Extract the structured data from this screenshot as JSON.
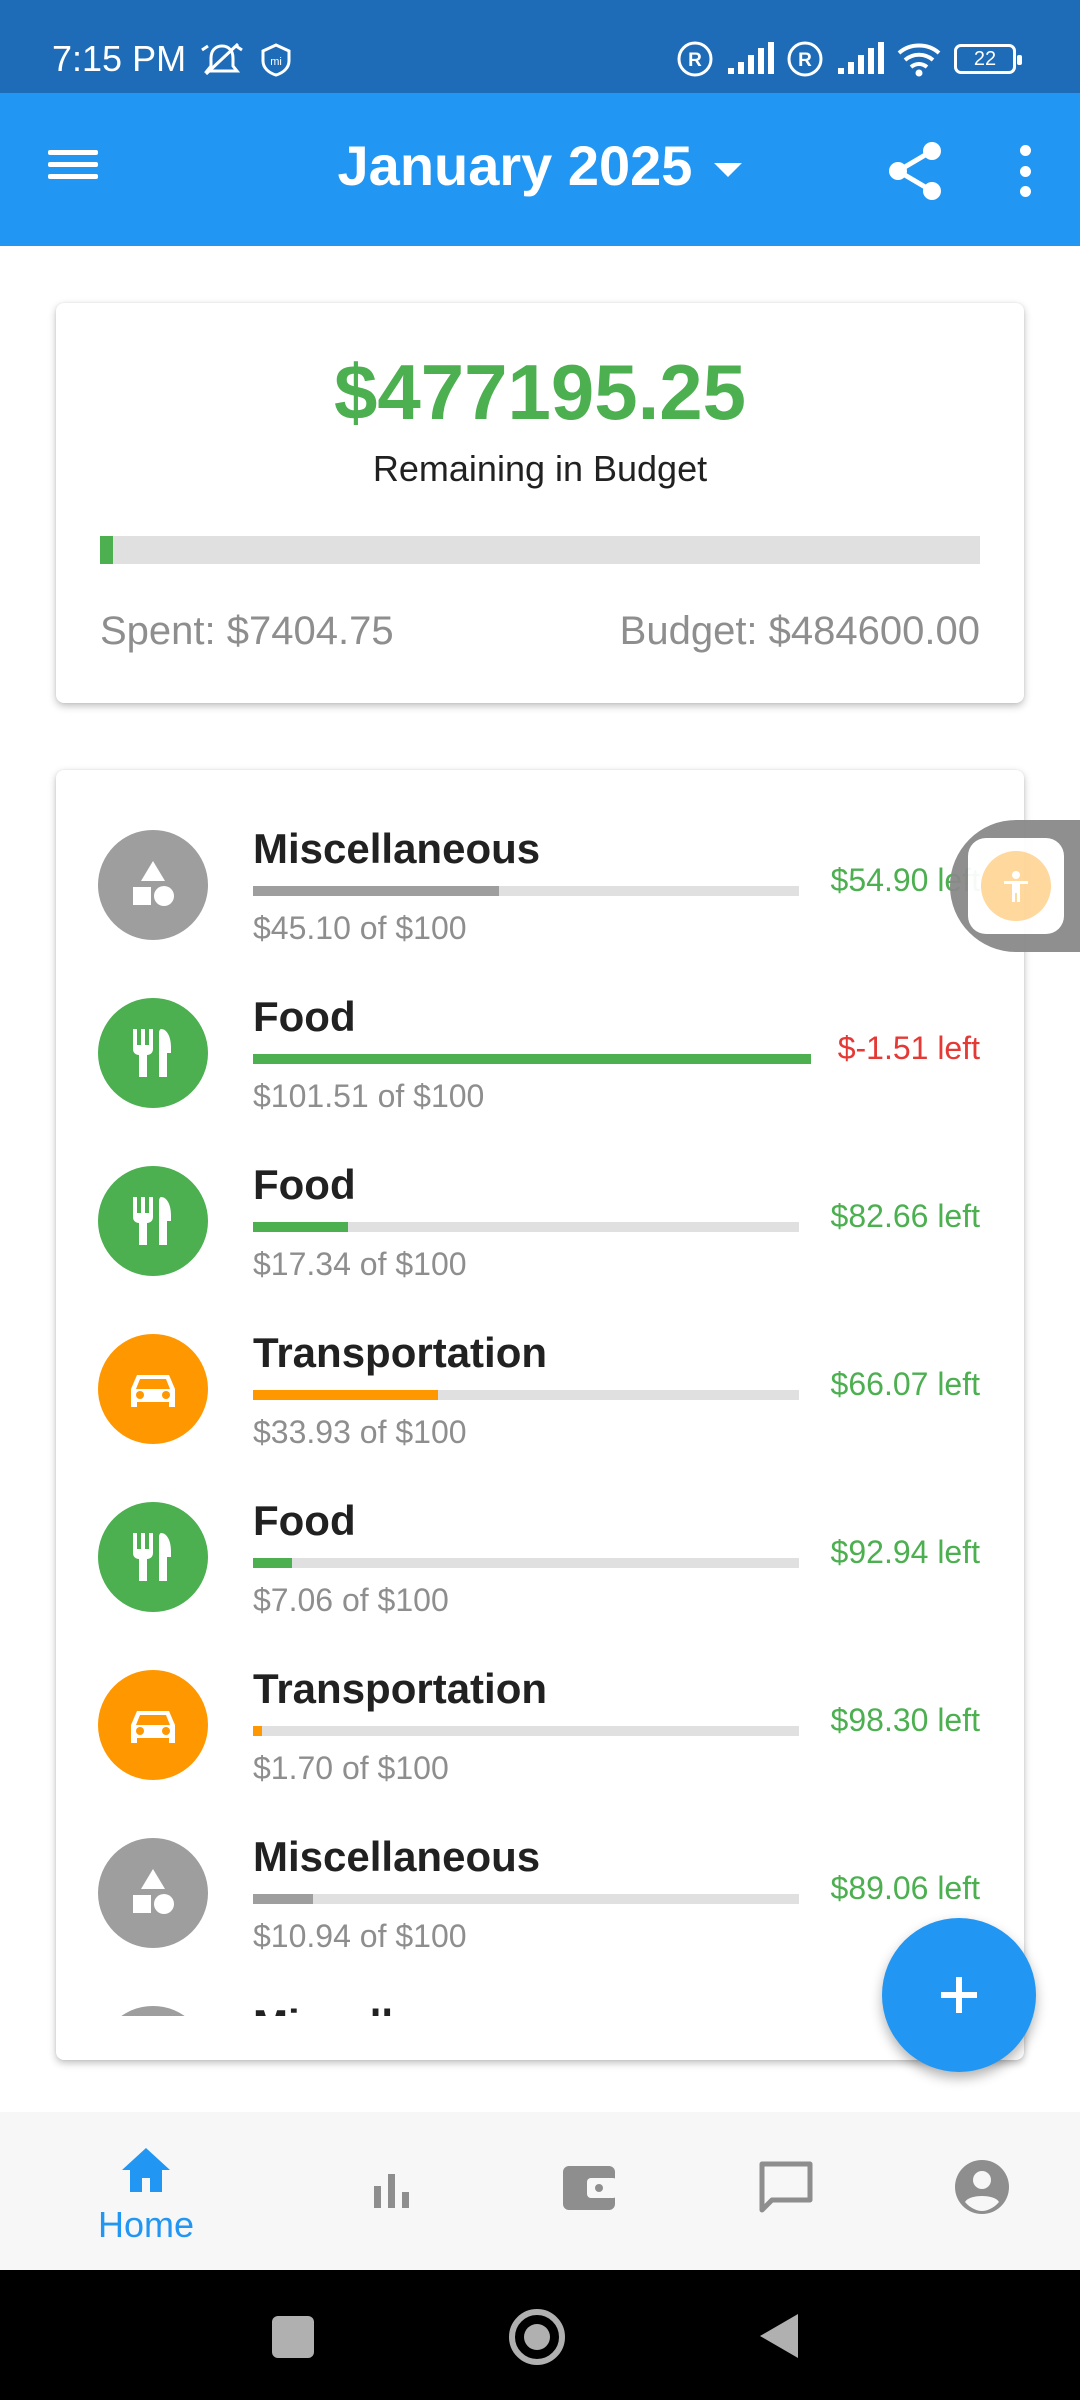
{
  "status_bar": {
    "time": "7:15 PM",
    "battery": "22"
  },
  "app_bar": {
    "title": "January 2025"
  },
  "summary": {
    "remaining_amount": "$477195.25",
    "remaining_label": "Remaining in Budget",
    "spent": "Spent: $7404.75",
    "budget": "Budget: $484600.00",
    "progress_fraction": 0.0153,
    "accent_color": "#4caf50"
  },
  "categories": [
    {
      "name": "Miscellaneous",
      "icon": "shapes-icon",
      "color": "#9e9e9e",
      "spent_text": "$45.10 of $100",
      "left_text": "$54.90 left",
      "progress": 0.451,
      "over": false
    },
    {
      "name": "Food",
      "icon": "restaurant-icon",
      "color": "#4caf50",
      "spent_text": "$101.51 of $100",
      "left_text": "$-1.51 left",
      "progress": 1.0,
      "over": true
    },
    {
      "name": "Food",
      "icon": "restaurant-icon",
      "color": "#4caf50",
      "spent_text": "$17.34 of $100",
      "left_text": "$82.66 left",
      "progress": 0.1734,
      "over": false
    },
    {
      "name": "Transportation",
      "icon": "car-icon",
      "color": "#ff9800",
      "spent_text": "$33.93 of $100",
      "left_text": "$66.07 left",
      "progress": 0.3393,
      "over": false
    },
    {
      "name": "Food",
      "icon": "restaurant-icon",
      "color": "#4caf50",
      "spent_text": "$7.06 of $100",
      "left_text": "$92.94 left",
      "progress": 0.0706,
      "over": false
    },
    {
      "name": "Transportation",
      "icon": "car-icon",
      "color": "#ff9800",
      "spent_text": "$1.70 of $100",
      "left_text": "$98.30 left",
      "progress": 0.017,
      "over": false
    },
    {
      "name": "Miscellaneous",
      "icon": "shapes-icon",
      "color": "#9e9e9e",
      "spent_text": "$10.94 of $100",
      "left_text": "$89.06 left",
      "progress": 0.1094,
      "over": false
    },
    {
      "name": "Miscellaneous",
      "icon": "shapes-icon",
      "color": "#9e9e9e",
      "spent_text": "",
      "left_text": "",
      "progress": 0,
      "over": false
    }
  ],
  "colors": {
    "left_ok": "#4caf50",
    "left_over": "#e53935",
    "primary": "#2196f3"
  },
  "bottom_nav": {
    "home_label": "Home"
  }
}
